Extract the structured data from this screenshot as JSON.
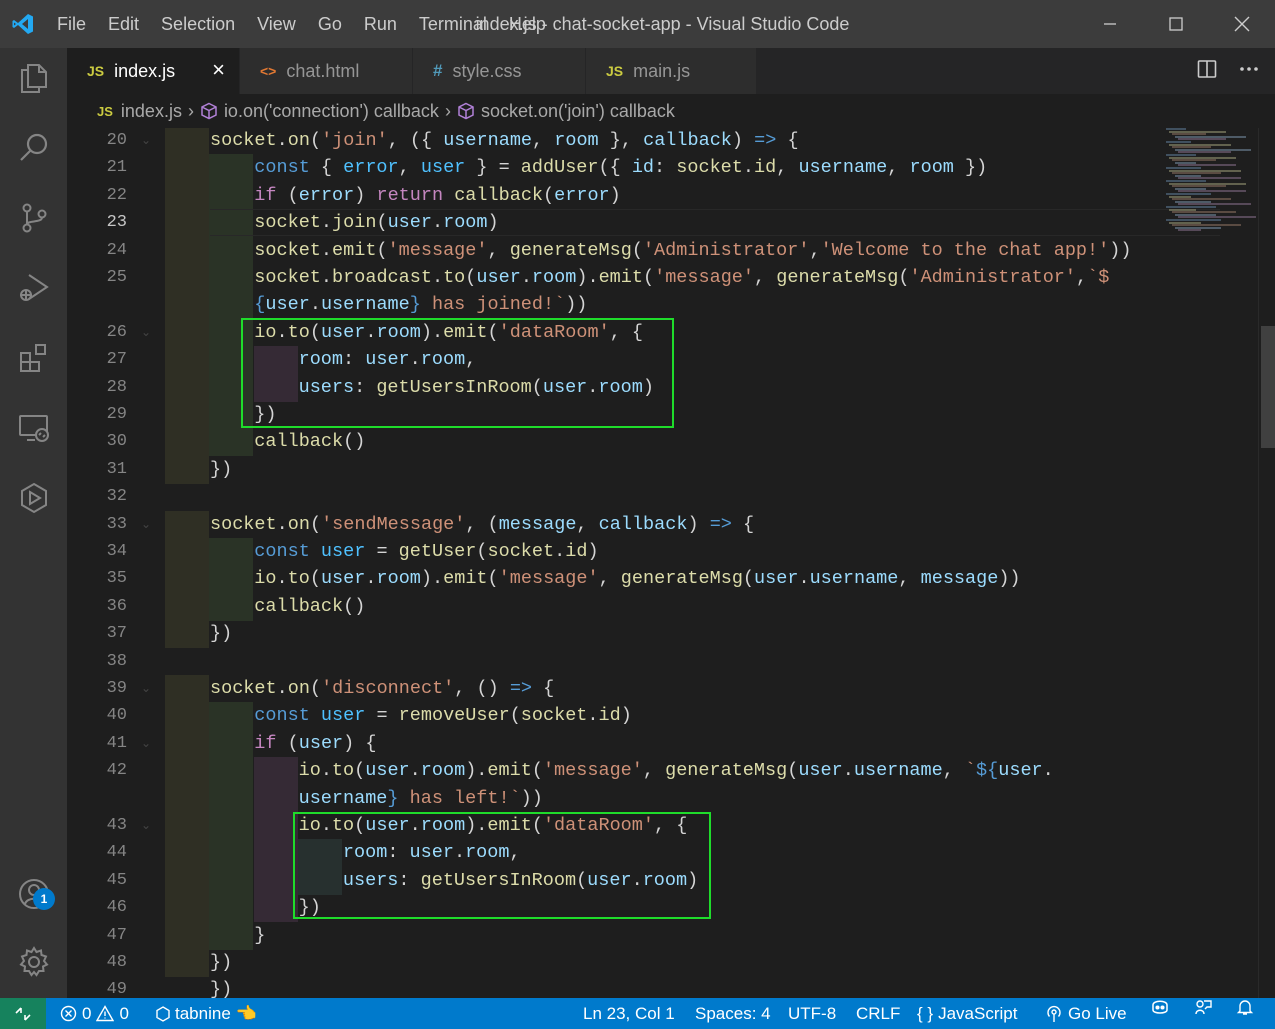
{
  "window": {
    "title": "index.js - chat-socket-app - Visual Studio Code",
    "menu": [
      "File",
      "Edit",
      "Selection",
      "View",
      "Go",
      "Run",
      "Terminal",
      "Help"
    ]
  },
  "tabs": [
    {
      "label": "index.js",
      "icon": "JS",
      "icon_color": "#cbcb41",
      "active": true
    },
    {
      "label": "chat.html",
      "icon": "<>",
      "icon_color": "#e37933",
      "active": false
    },
    {
      "label": "style.css",
      "icon": "#",
      "icon_color": "#519aba",
      "active": false
    },
    {
      "label": "main.js",
      "icon": "JS",
      "icon_color": "#cbcb41",
      "active": false
    }
  ],
  "breadcrumb": {
    "file_icon": "JS",
    "file": "index.js",
    "crumb1": "io.on('connection') callback",
    "crumb2": "socket.on('join') callback"
  },
  "editor": {
    "current_line": 23,
    "line_numbers": [
      "20",
      "21",
      "22",
      "23",
      "24",
      "25",
      "",
      "26",
      "27",
      "28",
      "29",
      "30",
      "31",
      "32",
      "33",
      "34",
      "35",
      "36",
      "37",
      "38",
      "39",
      "40",
      "41",
      "42",
      "",
      "43",
      "44",
      "45",
      "46",
      "47",
      "48",
      "49"
    ]
  },
  "activity_bar": {
    "items": [
      "explorer-icon",
      "search-icon",
      "source-control-icon",
      "run-debug-icon",
      "extensions-icon",
      "remote-explorer-icon",
      "live-share-icon"
    ],
    "accounts_badge": "1"
  },
  "statusbar": {
    "errors": "0",
    "warnings": "0",
    "tabnine": "tabnine",
    "tabnine_emoji": "👈",
    "position": "Ln 23, Col 1",
    "spaces": "Spaces: 4",
    "encoding": "UTF-8",
    "eol": "CRLF",
    "language": "JavaScript",
    "language_icon": "{ }",
    "golive": "Go Live"
  },
  "colors": {
    "accent": "#007acc",
    "highlight_box": "#1fdc2b",
    "remote": "#16825d"
  }
}
